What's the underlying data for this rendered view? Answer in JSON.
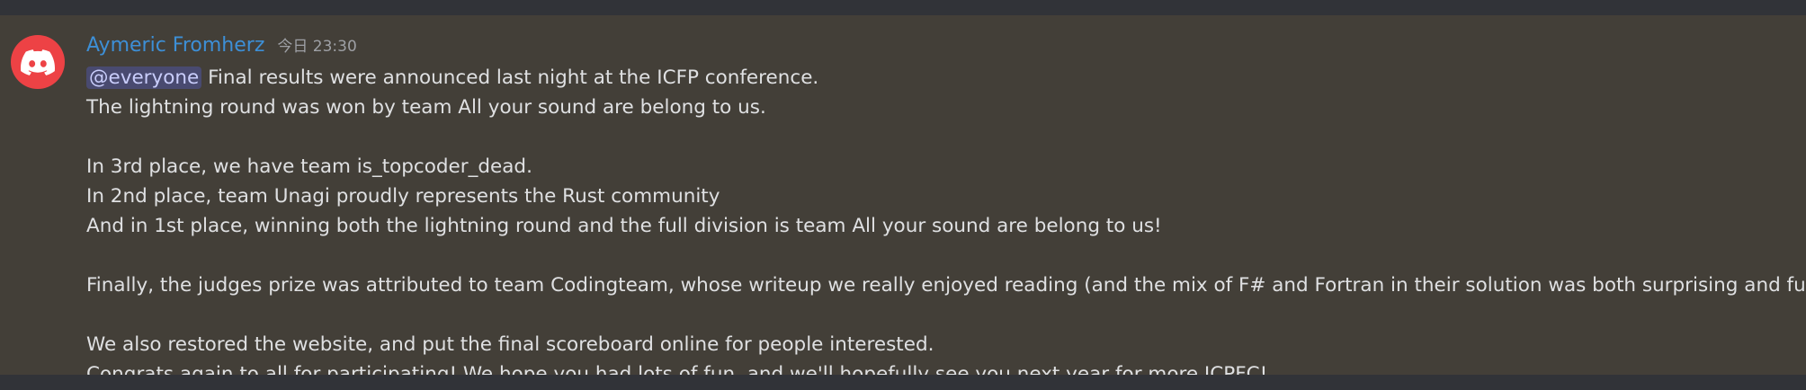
{
  "colors": {
    "background": "#313338",
    "message_highlight": "#433f38",
    "username": "#3d8fd6",
    "avatar": "#ed4245",
    "mention_bg": "#5865f2",
    "text": "#dfe0e2",
    "timestamp": "#9ea0a5"
  },
  "message": {
    "avatar_icon": "discord-logo-icon",
    "author": "Aymeric Fromherz",
    "timestamp": "今日 23:30",
    "mention": "@everyone",
    "line1_rest": " Final results were announced last night at the ICFP conference.",
    "line2": "The lightning round was won by team All your sound are belong to us.",
    "line3": "In 3rd place, we have team is_topcoder_dead.",
    "line4": "In 2nd place, team Unagi proudly represents the Rust community",
    "line5": "And in 1st place, winning both the lightning round and the full division is team All your sound are belong to us!",
    "line6": "Finally, the judges prize was attributed to team Codingteam, whose writeup we really enjoyed reading (and the mix of F# and Fortran in their solution was both surprising and fun to see)",
    "line7": "We also restored the website, and put the final scoreboard online for people interested.",
    "line8": "Congrats again to all for participating! We hope you had lots of fun, and we'll hopefully see you next year for more ICPFC!"
  }
}
